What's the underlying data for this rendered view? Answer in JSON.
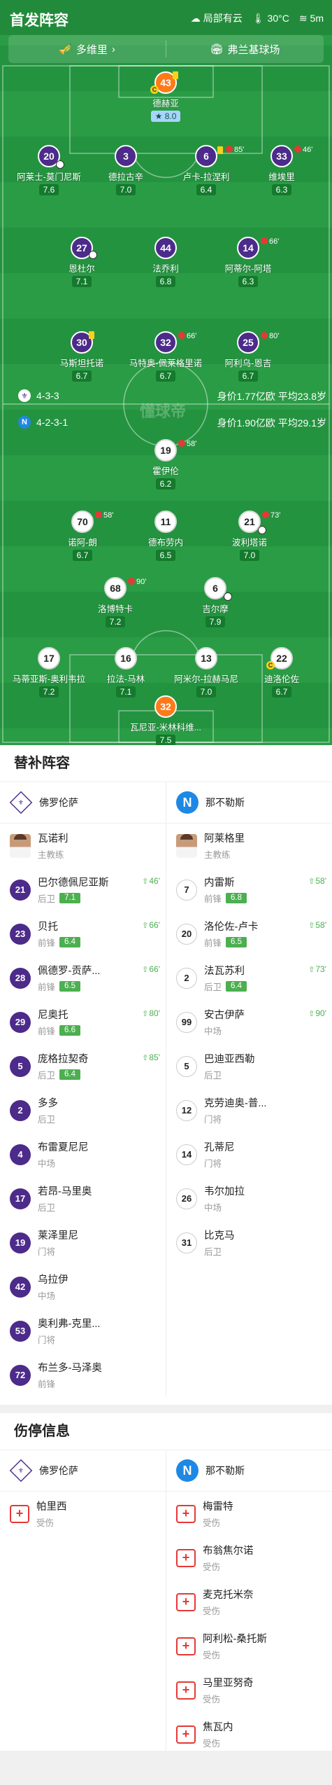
{
  "header": {
    "title": "首发阵容",
    "weather": "局部有云",
    "temp": "30°C",
    "wind": "5m"
  },
  "venue": {
    "coach_label": "多维里",
    "stadium": "弗兰基球场"
  },
  "watermark": "懂球帝",
  "fiorentina_formation": "4-3-3",
  "fiorentina_value": "身价1.77亿欧  平均23.8岁",
  "napoli_formation": "4-2-3-1",
  "napoli_value": "身价1.90亿欧  平均29.1岁",
  "pitch_players": {
    "fio_gk": {
      "num": "43",
      "name": "德赫亚",
      "rating": "8.0"
    },
    "fio_d1": {
      "num": "20",
      "name": "阿莱士-莫门尼斯",
      "rating": "7.6"
    },
    "fio_d2": {
      "num": "3",
      "name": "德拉古辛",
      "rating": "7.0"
    },
    "fio_d3": {
      "num": "6",
      "name": "卢卡-拉涅利",
      "rating": "6.4",
      "sub": "85'"
    },
    "fio_d4": {
      "num": "33",
      "name": "维埃里",
      "rating": "6.3",
      "sub": "46'"
    },
    "fio_m1": {
      "num": "27",
      "name": "恩杜尔",
      "rating": "7.1"
    },
    "fio_m2": {
      "num": "44",
      "name": "法乔利",
      "rating": "6.8"
    },
    "fio_m3": {
      "num": "14",
      "name": "阿蒂尔-阿塔",
      "rating": "6.3",
      "sub": "66'"
    },
    "fio_f1": {
      "num": "30",
      "name": "马斯坦托诺",
      "rating": "6.7"
    },
    "fio_f2": {
      "num": "32",
      "name": "马特奥-佩莱格里诺",
      "rating": "6.7",
      "sub": "66'"
    },
    "fio_f3": {
      "num": "25",
      "name": "阿利乌-恩吉",
      "rating": "6.7",
      "sub": "80'"
    },
    "nap_f": {
      "num": "19",
      "name": "霍伊伦",
      "rating": "6.2",
      "sub": "58'"
    },
    "nap_am1": {
      "num": "70",
      "name": "诺阿-朗",
      "rating": "6.7",
      "sub": "58'"
    },
    "nap_am2": {
      "num": "11",
      "name": "德布劳内",
      "rating": "6.5"
    },
    "nap_am3": {
      "num": "21",
      "name": "波利塔诺",
      "rating": "7.0",
      "sub": "73'"
    },
    "nap_dm1": {
      "num": "68",
      "name": "洛博特卡",
      "rating": "7.2",
      "sub": "90'"
    },
    "nap_dm2": {
      "num": "6",
      "name": "吉尔摩",
      "rating": "7.9"
    },
    "nap_d1": {
      "num": "17",
      "name": "马蒂亚斯-奥利韦拉",
      "rating": "7.2"
    },
    "nap_d2": {
      "num": "16",
      "name": "拉法-马林",
      "rating": "7.1"
    },
    "nap_d3": {
      "num": "13",
      "name": "阿米尔-拉赫马尼",
      "rating": "7.0"
    },
    "nap_d4": {
      "num": "22",
      "name": "迪洛伦佐",
      "rating": "6.7"
    },
    "nap_gk": {
      "num": "32",
      "name": "瓦尼亚-米林科维...",
      "rating": "7.5"
    }
  },
  "subs": {
    "title": "替补阵容",
    "team_left": "佛罗伦萨",
    "team_right": "那不勒斯",
    "coach_left": {
      "name": "瓦诺利",
      "role": "主教练"
    },
    "coach_right": {
      "name": "阿莱格里",
      "role": "主教练"
    },
    "left": [
      {
        "num": "21",
        "name": "巴尔德佩尼亚斯",
        "pos": "后卫",
        "rating": "7.1",
        "time": "46'"
      },
      {
        "num": "23",
        "name": "贝托",
        "pos": "前锋",
        "rating": "6.4",
        "time": "66'"
      },
      {
        "num": "28",
        "name": "佩德罗-贡萨...",
        "pos": "前锋",
        "rating": "6.5",
        "time": "66'"
      },
      {
        "num": "29",
        "name": "尼奥托",
        "pos": "前锋",
        "rating": "6.6",
        "time": "80'"
      },
      {
        "num": "5",
        "name": "庞格拉契奇",
        "pos": "后卫",
        "rating": "6.4",
        "time": "85'"
      },
      {
        "num": "2",
        "name": "多多",
        "pos": "后卫"
      },
      {
        "num": "4",
        "name": "布雷夏尼尼",
        "pos": "中场"
      },
      {
        "num": "17",
        "name": "若昂-马里奥",
        "pos": "后卫"
      },
      {
        "num": "19",
        "name": "莱泽里尼",
        "pos": "门将"
      },
      {
        "num": "42",
        "name": "乌拉伊",
        "pos": "中场"
      },
      {
        "num": "53",
        "name": "奥利弗-克里...",
        "pos": "门将"
      },
      {
        "num": "72",
        "name": "布兰多-马泽奥",
        "pos": "前锋"
      }
    ],
    "right": [
      {
        "num": "7",
        "name": "内雷斯",
        "pos": "前锋",
        "rating": "6.8",
        "time": "58'"
      },
      {
        "num": "20",
        "name": "洛伦佐-卢卡",
        "pos": "前锋",
        "rating": "6.5",
        "time": "58'"
      },
      {
        "num": "2",
        "name": "法瓦苏利",
        "pos": "后卫",
        "rating": "6.4",
        "time": "73'"
      },
      {
        "num": "99",
        "name": "安古伊萨",
        "pos": "中场",
        "time": "90'"
      },
      {
        "num": "5",
        "name": "巴迪亚西勒",
        "pos": "后卫"
      },
      {
        "num": "12",
        "name": "克劳迪奥-普...",
        "pos": "门将"
      },
      {
        "num": "14",
        "name": "孔蒂尼",
        "pos": "门将"
      },
      {
        "num": "26",
        "name": "韦尔加拉",
        "pos": "中场"
      },
      {
        "num": "31",
        "name": "比克马",
        "pos": "后卫"
      }
    ]
  },
  "injuries": {
    "title": "伤停信息",
    "team_left": "佛罗伦萨",
    "team_right": "那不勒斯",
    "left": [
      {
        "name": "帕里西",
        "status": "受伤"
      }
    ],
    "right": [
      {
        "name": "梅雷特",
        "status": "受伤"
      },
      {
        "name": "布翁焦尔诺",
        "status": "受伤"
      },
      {
        "name": "麦克托米奈",
        "status": "受伤"
      },
      {
        "name": "阿利松-桑托斯",
        "status": "受伤"
      },
      {
        "name": "马里亚努奇",
        "status": "受伤"
      },
      {
        "name": "焦瓦内",
        "status": "受伤"
      }
    ]
  }
}
